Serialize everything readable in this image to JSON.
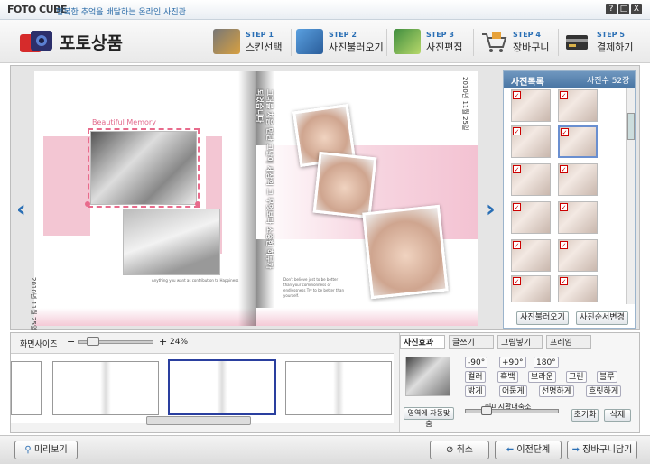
{
  "titlebar": {
    "brand": "FOTO CUBE",
    "tagline": "행복한 추억을 배달하는 온라인 사진관",
    "help": "?",
    "minimize": "□",
    "close": "X"
  },
  "header": {
    "title": "포토상품"
  },
  "steps": [
    {
      "num": "STEP 1",
      "label": "스킨선택"
    },
    {
      "num": "STEP 2",
      "label": "사진불러오기"
    },
    {
      "num": "STEP 3",
      "label": "사진편집"
    },
    {
      "num": "STEP 4",
      "label": "장바구니"
    },
    {
      "num": "STEP 5",
      "label": "결제하기"
    }
  ],
  "book": {
    "memory_text": "Beautiful Memory",
    "caption_small": "Anything you want as contribution to Happiness",
    "left_spine": "2010년 11월 25일",
    "right_spine": "2010년 11월 25일",
    "poem": "Don't believe just to be better than your commonness or endlessness Try to be better than yourself.",
    "vertical_text": "그대를 처음 만난 그날이 세상의 그 무엇보다 소중한 하루가 되었습니다"
  },
  "panel": {
    "title": "사진목록",
    "count": "사진수 52장",
    "load_button": "사진불러오기",
    "sort_button": "사진순서변경"
  },
  "lower": {
    "screen_size_label": "화면사이즈",
    "zoom_minus": "−",
    "zoom_plus": "+",
    "zoom_value": "24%",
    "tabs": [
      "사진효과",
      "글쓰기",
      "그림넣기",
      "프레임"
    ],
    "rotate": [
      "-90°",
      "+90°",
      "180°"
    ],
    "colors": [
      "컬러",
      "흑백",
      "브라운",
      "그린",
      "블루"
    ],
    "brightness": [
      "밝게",
      "어둡게",
      "선명하게",
      "흐릿하게"
    ],
    "auto_fit": "영역에 자동맞춤",
    "enlarge_label": "이미지확대축소",
    "reset": "초기화",
    "delete": "삭제"
  },
  "footer": {
    "preview": "미리보기",
    "cancel": "취소",
    "prev": "이전단계",
    "cart": "장바구니담기"
  }
}
